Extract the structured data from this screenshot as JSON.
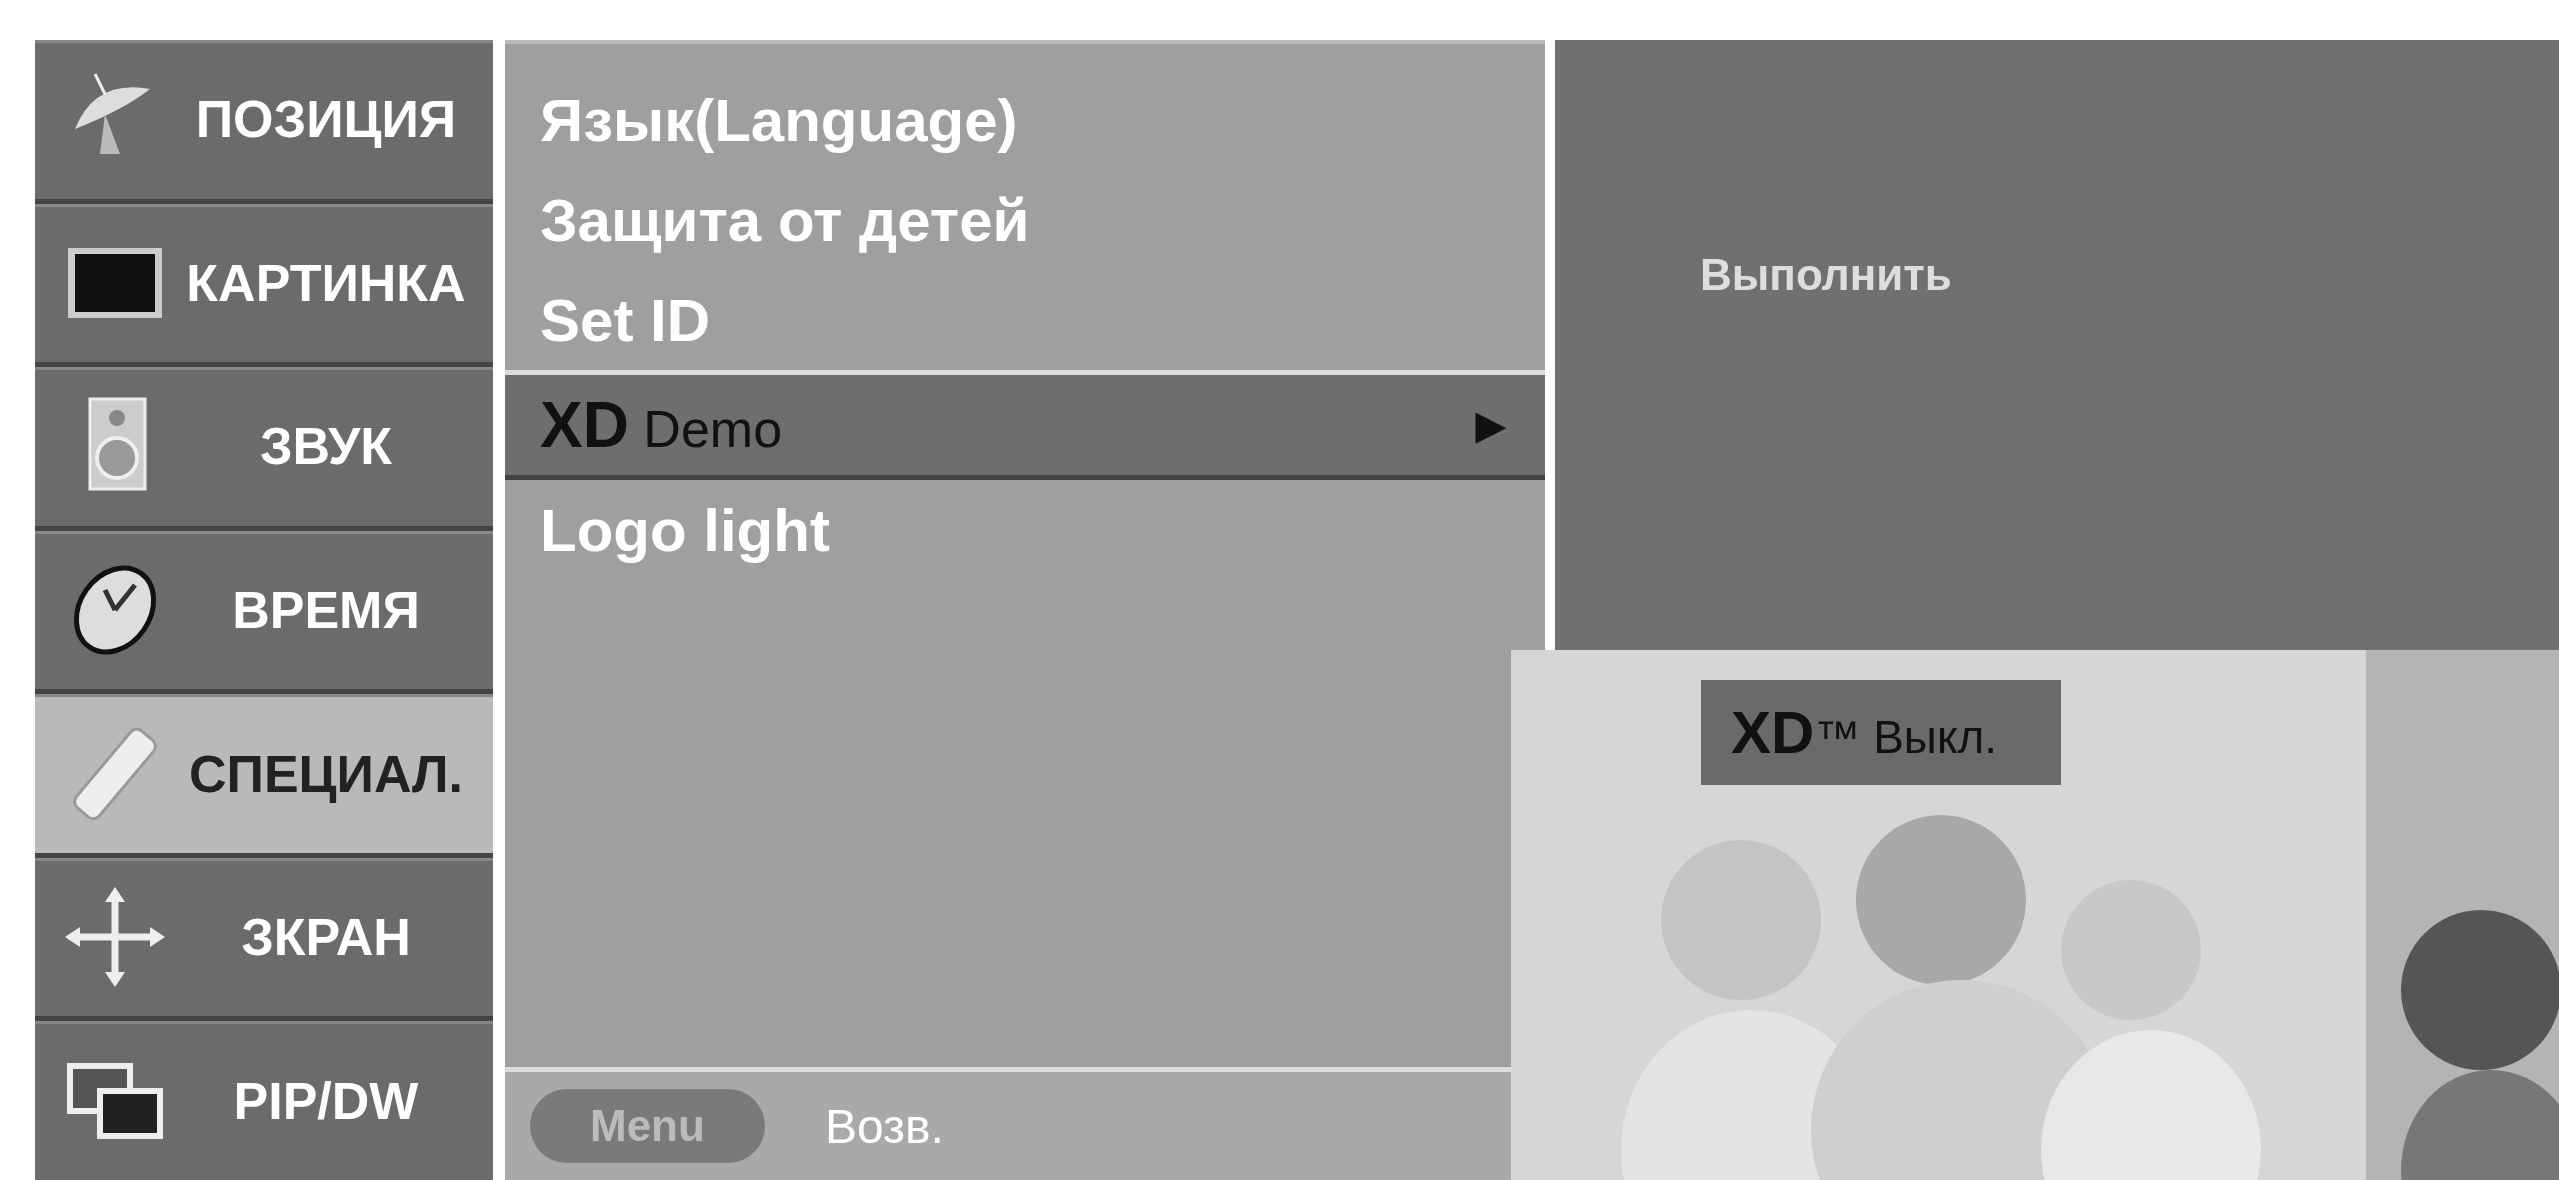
{
  "sidebar": {
    "items": [
      {
        "label": "ПОЗИЦИЯ",
        "kind": "satellite",
        "selected": false
      },
      {
        "label": "КАРТИНКА",
        "kind": "screen",
        "selected": false
      },
      {
        "label": "ЗВУК",
        "kind": "speaker",
        "selected": false
      },
      {
        "label": "ВРЕМЯ",
        "kind": "clock",
        "selected": false
      },
      {
        "label": "СПЕЦИАЛ.",
        "kind": "remote",
        "selected": true
      },
      {
        "label": "ЗКРАН",
        "kind": "arrows",
        "selected": false
      },
      {
        "label": "PIP/DW",
        "kind": "windows",
        "selected": false
      }
    ]
  },
  "menu": {
    "items": [
      {
        "label": "Язык(Language)",
        "selected": false
      },
      {
        "label": "Защита от детей",
        "selected": false
      },
      {
        "label": "Set ID",
        "selected": false
      },
      {
        "label": "**XD** Demo",
        "selected": true,
        "arrow": "▶"
      },
      {
        "label": "Logo light",
        "selected": false
      }
    ],
    "footer": {
      "button": "Menu",
      "label": "Возв."
    }
  },
  "submenu": {
    "action": "Выполнить"
  },
  "preview": {
    "kind": "picture",
    "badge": "**XD**™ Выкл."
  }
}
